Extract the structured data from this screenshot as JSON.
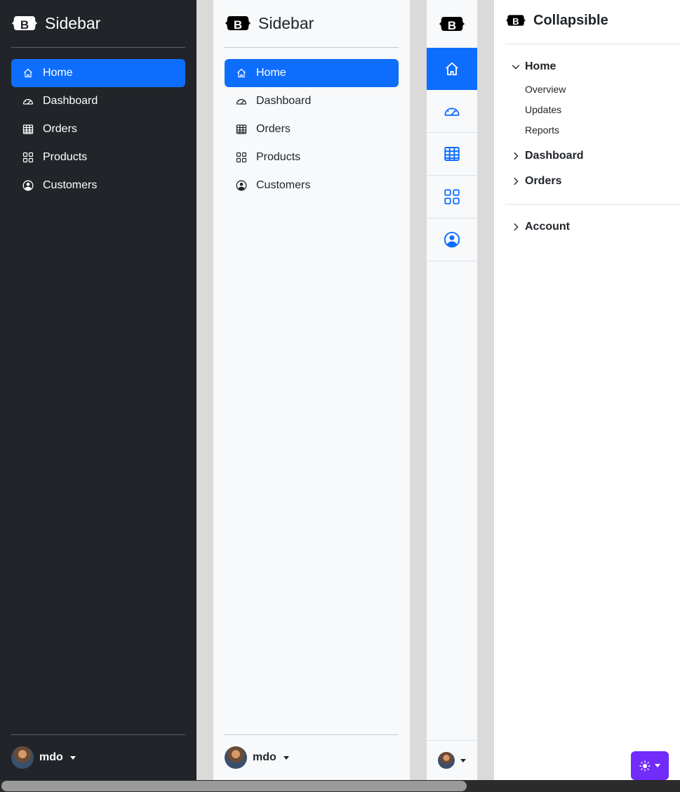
{
  "dark_sidebar": {
    "brand": "Sidebar",
    "items": [
      {
        "label": "Home",
        "icon": "home-icon",
        "active": true
      },
      {
        "label": "Dashboard",
        "icon": "speedometer-icon"
      },
      {
        "label": "Orders",
        "icon": "table-icon"
      },
      {
        "label": "Products",
        "icon": "grid-icon"
      },
      {
        "label": "Customers",
        "icon": "person-circle-icon"
      }
    ],
    "user": "mdo"
  },
  "light_sidebar": {
    "brand": "Sidebar",
    "items": [
      {
        "label": "Home",
        "icon": "home-icon",
        "active": true
      },
      {
        "label": "Dashboard",
        "icon": "speedometer-icon"
      },
      {
        "label": "Orders",
        "icon": "table-icon"
      },
      {
        "label": "Products",
        "icon": "grid-icon"
      },
      {
        "label": "Customers",
        "icon": "person-circle-icon"
      }
    ],
    "user": "mdo"
  },
  "icon_sidebar": {
    "items": [
      "home-icon",
      "speedometer-icon",
      "table-icon",
      "grid-icon",
      "person-circle-icon"
    ]
  },
  "collapsible": {
    "title": "Collapsible",
    "home": {
      "label": "Home",
      "children": [
        "Overview",
        "Updates",
        "Reports"
      ]
    },
    "dashboard": "Dashboard",
    "orders": "Orders",
    "account": "Account"
  },
  "colors": {
    "primary": "#0d6efd",
    "dark": "#212529",
    "theme_toggle": "#712cf9"
  }
}
